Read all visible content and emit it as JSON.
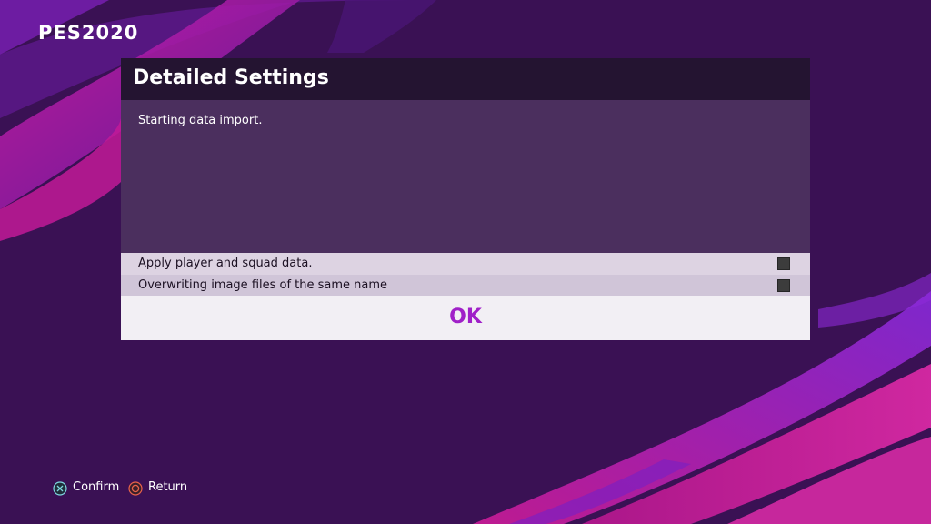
{
  "app": {
    "logo_text": "PES2020"
  },
  "dialog": {
    "title": "Detailed Settings",
    "message": "Starting data import.",
    "options": [
      {
        "label": "Apply player and squad data.",
        "checked": false
      },
      {
        "label": "Overwriting image files of the same name",
        "checked": false
      }
    ],
    "ok_label": "OK"
  },
  "hints": {
    "confirm": {
      "icon": "cross-button-icon",
      "label": "Confirm"
    },
    "return": {
      "icon": "circle-button-icon",
      "label": "Return"
    }
  },
  "colors": {
    "background": "#3a1154",
    "accent": "#a020c8",
    "header": "#241431",
    "message_area": "#4b2f5e"
  }
}
